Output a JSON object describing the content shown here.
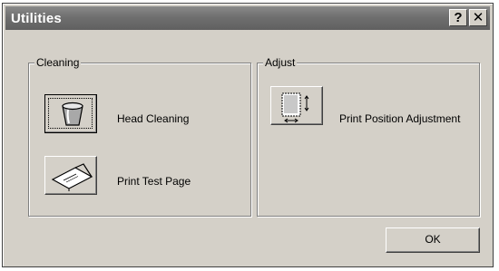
{
  "window": {
    "title": "Utilities",
    "help_glyph": "?",
    "close_glyph": "✕"
  },
  "cleaning": {
    "legend": "Cleaning",
    "head_cleaning": {
      "label": "Head Cleaning",
      "icon": "head-cleaning-icon"
    },
    "print_test_page": {
      "label": "Print Test Page",
      "icon": "test-page-icon"
    }
  },
  "adjust": {
    "legend": "Adjust",
    "print_position": {
      "label": "Print Position Adjustment",
      "icon": "print-position-icon"
    }
  },
  "footer": {
    "ok_label": "OK"
  }
}
